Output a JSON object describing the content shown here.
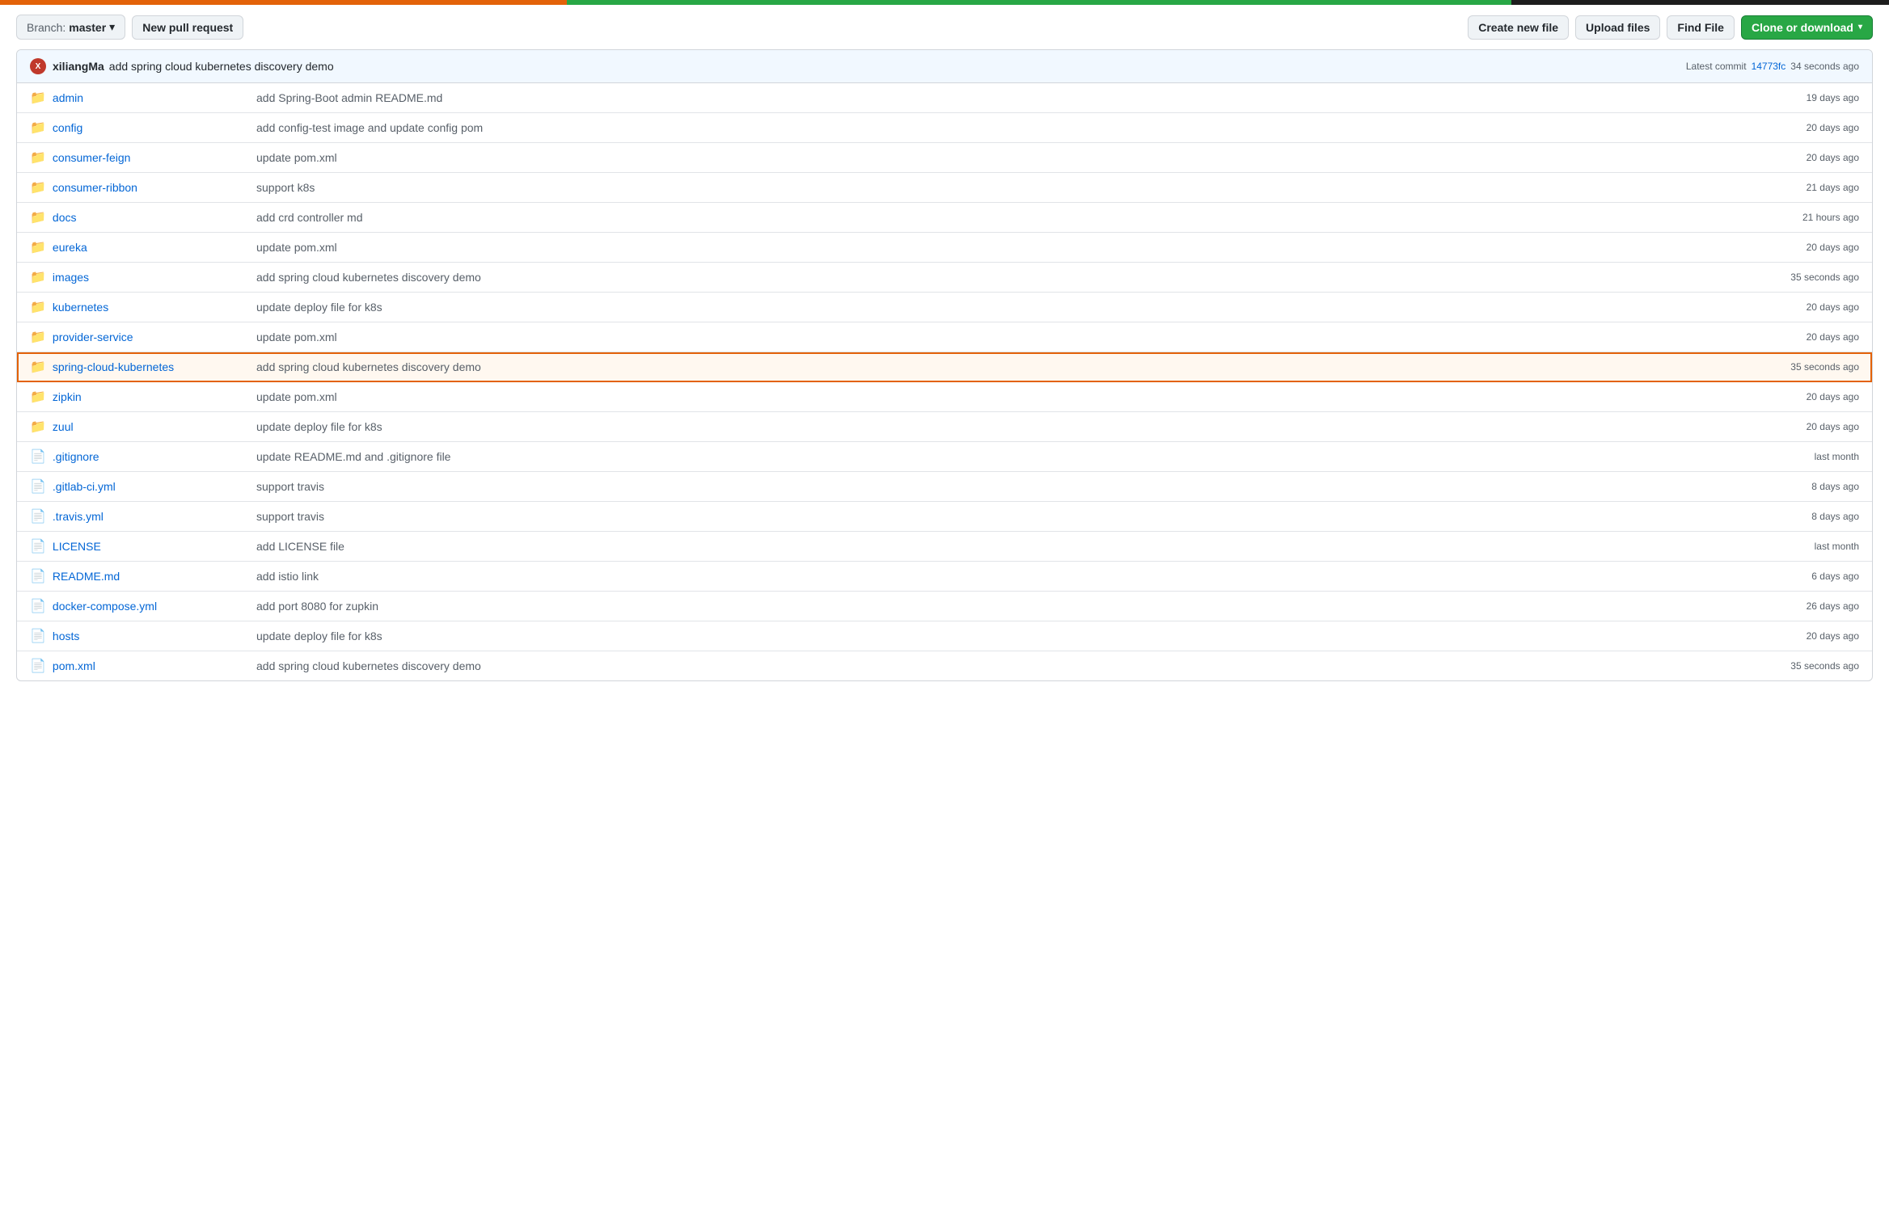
{
  "topbar": {
    "progress_segments": [
      "orange",
      "green",
      "dark"
    ]
  },
  "toolbar": {
    "branch_label": "Branch:",
    "branch_name": "master",
    "new_pr_label": "New pull request",
    "create_file_label": "Create new file",
    "upload_label": "Upload files",
    "find_label": "Find File",
    "clone_label": "Clone or download",
    "chevron": "▾"
  },
  "commit": {
    "author": "xiliangMa",
    "message": "add spring cloud kubernetes discovery demo",
    "latest_label": "Latest commit",
    "hash": "14773fc",
    "time": "34 seconds ago"
  },
  "files": [
    {
      "type": "folder",
      "name": "admin",
      "commit": "add Spring-Boot admin README.md",
      "time": "19 days ago"
    },
    {
      "type": "folder",
      "name": "config",
      "commit": "add config-test image and update config pom",
      "time": "20 days ago"
    },
    {
      "type": "folder",
      "name": "consumer-feign",
      "commit": "update pom.xml",
      "time": "20 days ago"
    },
    {
      "type": "folder",
      "name": "consumer-ribbon",
      "commit": "support k8s",
      "time": "21 days ago"
    },
    {
      "type": "folder",
      "name": "docs",
      "commit": "add crd controller md",
      "time": "21 hours ago"
    },
    {
      "type": "folder",
      "name": "eureka",
      "commit": "update pom.xml",
      "time": "20 days ago"
    },
    {
      "type": "folder",
      "name": "images",
      "commit": "add spring cloud kubernetes discovery demo",
      "time": "35 seconds ago"
    },
    {
      "type": "folder",
      "name": "kubernetes",
      "commit": "update deploy file for k8s",
      "time": "20 days ago"
    },
    {
      "type": "folder",
      "name": "provider-service",
      "commit": "update pom.xml",
      "time": "20 days ago"
    },
    {
      "type": "folder",
      "name": "spring-cloud-kubernetes",
      "commit": "add spring cloud kubernetes discovery demo",
      "time": "35 seconds ago",
      "highlighted": true
    },
    {
      "type": "folder",
      "name": "zipkin",
      "commit": "update pom.xml",
      "time": "20 days ago"
    },
    {
      "type": "folder",
      "name": "zuul",
      "commit": "update deploy file for k8s",
      "time": "20 days ago"
    },
    {
      "type": "file",
      "name": ".gitignore",
      "commit": "update README.md and .gitignore file",
      "time": "last month"
    },
    {
      "type": "file",
      "name": ".gitlab-ci.yml",
      "commit": "support travis",
      "time": "8 days ago"
    },
    {
      "type": "file",
      "name": ".travis.yml",
      "commit": "support travis",
      "time": "8 days ago"
    },
    {
      "type": "file",
      "name": "LICENSE",
      "commit": "add LICENSE file",
      "time": "last month"
    },
    {
      "type": "file",
      "name": "README.md",
      "commit": "add istio link",
      "time": "6 days ago"
    },
    {
      "type": "file",
      "name": "docker-compose.yml",
      "commit": "add port 8080 for zupkin",
      "time": "26 days ago"
    },
    {
      "type": "file",
      "name": "hosts",
      "commit": "update deploy file for k8s",
      "time": "20 days ago"
    },
    {
      "type": "file",
      "name": "pom.xml",
      "commit": "add spring cloud kubernetes discovery demo",
      "time": "35 seconds ago"
    }
  ]
}
